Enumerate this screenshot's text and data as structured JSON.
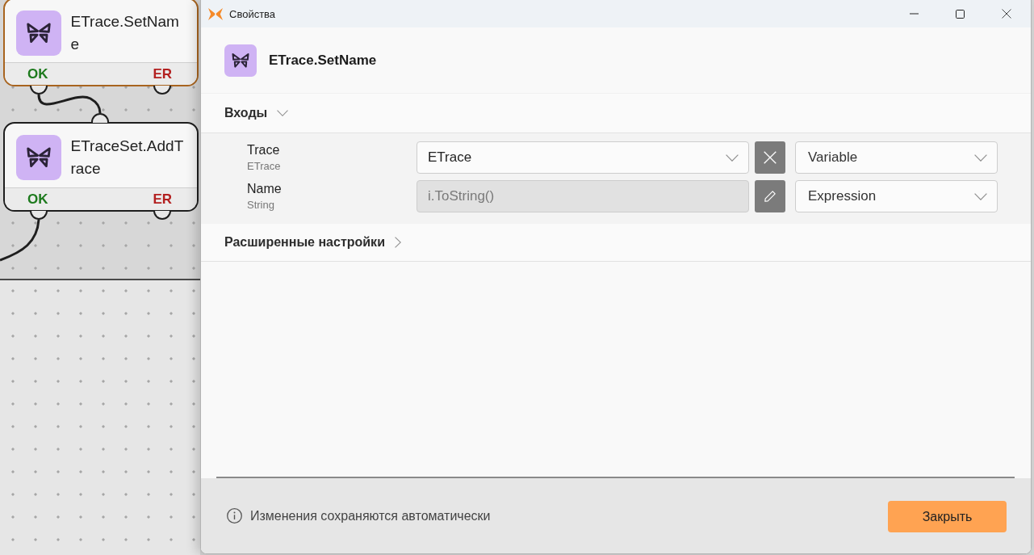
{
  "canvas": {
    "nodes": [
      {
        "title_lines": [
          "ETrace.SetNam",
          "e"
        ],
        "selected": true,
        "ok_label": "OK",
        "error_label": "ER"
      },
      {
        "title_lines": [
          "ETraceSet.AddT",
          "race"
        ],
        "selected": false,
        "ok_label": "OK",
        "error_label": "ER"
      }
    ]
  },
  "dialog": {
    "title": "Свойства",
    "header": {
      "title": "ETrace.SetName"
    },
    "sections": [
      {
        "title": "Входы",
        "expanded": true,
        "rows": [
          {
            "label": "Trace",
            "type": "ETrace",
            "kind": "select",
            "disabled": false,
            "value": "ETrace",
            "mode": "Variable"
          },
          {
            "label": "Name",
            "type": "String",
            "kind": "input",
            "disabled": true,
            "value": "i.ToString()",
            "mode": "Expression"
          }
        ]
      },
      {
        "title": "Расширенные настройки",
        "expanded": false
      }
    ],
    "footer": {
      "note": "Изменения сохраняются автоматически",
      "close_button": "Закрыть"
    }
  }
}
